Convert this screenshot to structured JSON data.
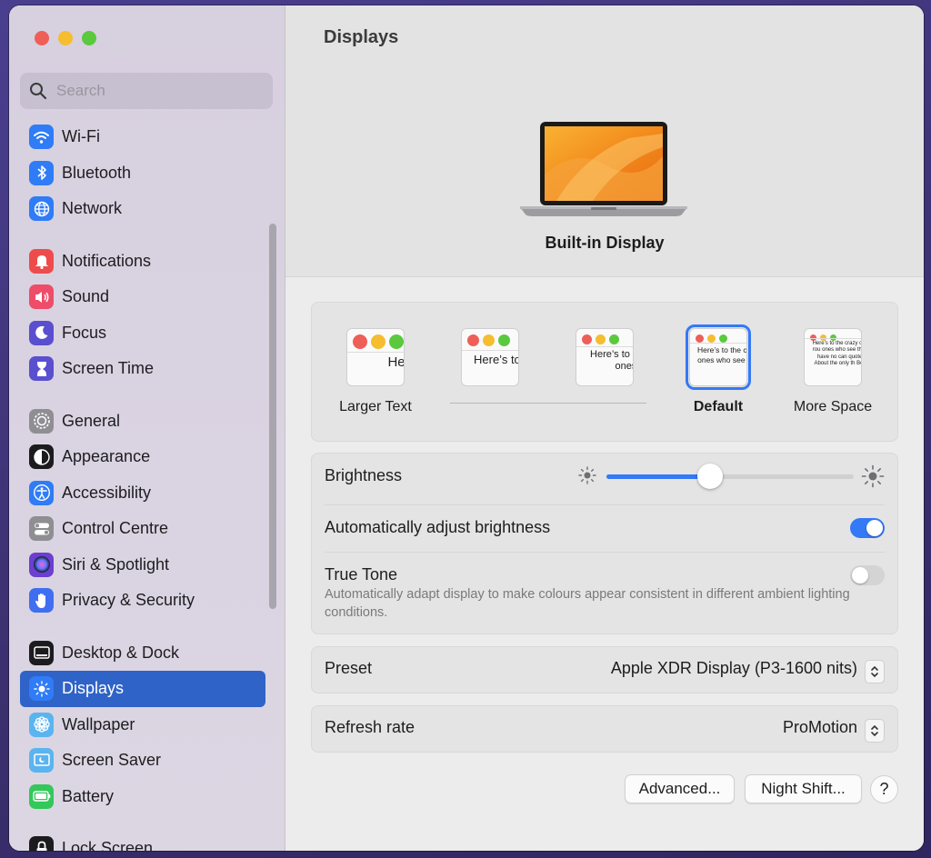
{
  "window": {
    "title": "Displays"
  },
  "search": {
    "placeholder": "Search"
  },
  "sidebar": {
    "groups": [
      [
        {
          "label": "Wi-Fi",
          "icon": "wifi-icon",
          "color": "#2f7cf6"
        },
        {
          "label": "Bluetooth",
          "icon": "bluetooth-icon",
          "color": "#2f7cf6"
        },
        {
          "label": "Network",
          "icon": "globe-icon",
          "color": "#2f7cf6"
        }
      ],
      [
        {
          "label": "Notifications",
          "icon": "bell-icon",
          "color": "#ee4c4c"
        },
        {
          "label": "Sound",
          "icon": "speaker-icon",
          "color": "#ee4c68"
        },
        {
          "label": "Focus",
          "icon": "moon-icon",
          "color": "#5a4fcf"
        },
        {
          "label": "Screen Time",
          "icon": "hourglass-icon",
          "color": "#5a4fcf"
        }
      ],
      [
        {
          "label": "General",
          "icon": "gear-icon",
          "color": "#8e8e93"
        },
        {
          "label": "Appearance",
          "icon": "appearance-icon",
          "color": "#1c1c1e"
        },
        {
          "label": "Accessibility",
          "icon": "accessibility-icon",
          "color": "#2f7cf6"
        },
        {
          "label": "Control Centre",
          "icon": "switches-icon",
          "color": "#8e8e93"
        },
        {
          "label": "Siri & Spotlight",
          "icon": "siri-icon",
          "color": "#6b3fd1"
        },
        {
          "label": "Privacy & Security",
          "icon": "hand-icon",
          "color": "#3f6ff0"
        }
      ],
      [
        {
          "label": "Desktop & Dock",
          "icon": "dock-icon",
          "color": "#1c1c1e"
        },
        {
          "label": "Displays",
          "icon": "sun-icon",
          "color": "#2f7cf6",
          "active": true
        },
        {
          "label": "Wallpaper",
          "icon": "flower-icon",
          "color": "#5ab4f0"
        },
        {
          "label": "Screen Saver",
          "icon": "screensaver-icon",
          "color": "#5ab4f0"
        },
        {
          "label": "Battery",
          "icon": "battery-icon",
          "color": "#34c759"
        }
      ],
      [
        {
          "label": "Lock Screen",
          "icon": "lock-icon",
          "color": "#1c1c1e"
        }
      ]
    ]
  },
  "main": {
    "title": "Displays",
    "display_name": "Built-in Display",
    "resolution": {
      "options": [
        {
          "label": "Larger Text",
          "preview": "Here’s"
        },
        {
          "label": "",
          "preview": "Here’s to troublem"
        },
        {
          "label": "",
          "preview": "Here’s to t troublema ones who"
        },
        {
          "label": "Default",
          "preview": "Here’s to the cr troublemakers. ones who see t rules. And they",
          "selected": true
        },
        {
          "label": "More Space",
          "preview": "Here’s to the crazy one troublemakers. The rou ones who see things dif rules. And they have no can quote them, disagre them. About the only th Because they change th"
        }
      ]
    },
    "brightness": {
      "label": "Brightness",
      "value": 0.42
    },
    "auto_brightness": {
      "label": "Automatically adjust brightness",
      "on": true
    },
    "true_tone": {
      "label": "True Tone",
      "description": "Automatically adapt display to make colours appear consistent in different ambient lighting conditions.",
      "on": false
    },
    "preset": {
      "label": "Preset",
      "value": "Apple XDR Display (P3-1600 nits)"
    },
    "refresh_rate": {
      "label": "Refresh rate",
      "value": "ProMotion"
    },
    "buttons": {
      "advanced": "Advanced...",
      "night_shift": "Night Shift...",
      "help": "?"
    }
  },
  "colors": {
    "accent": "#3479f6",
    "sidebar_selected": "#2f63c7"
  }
}
